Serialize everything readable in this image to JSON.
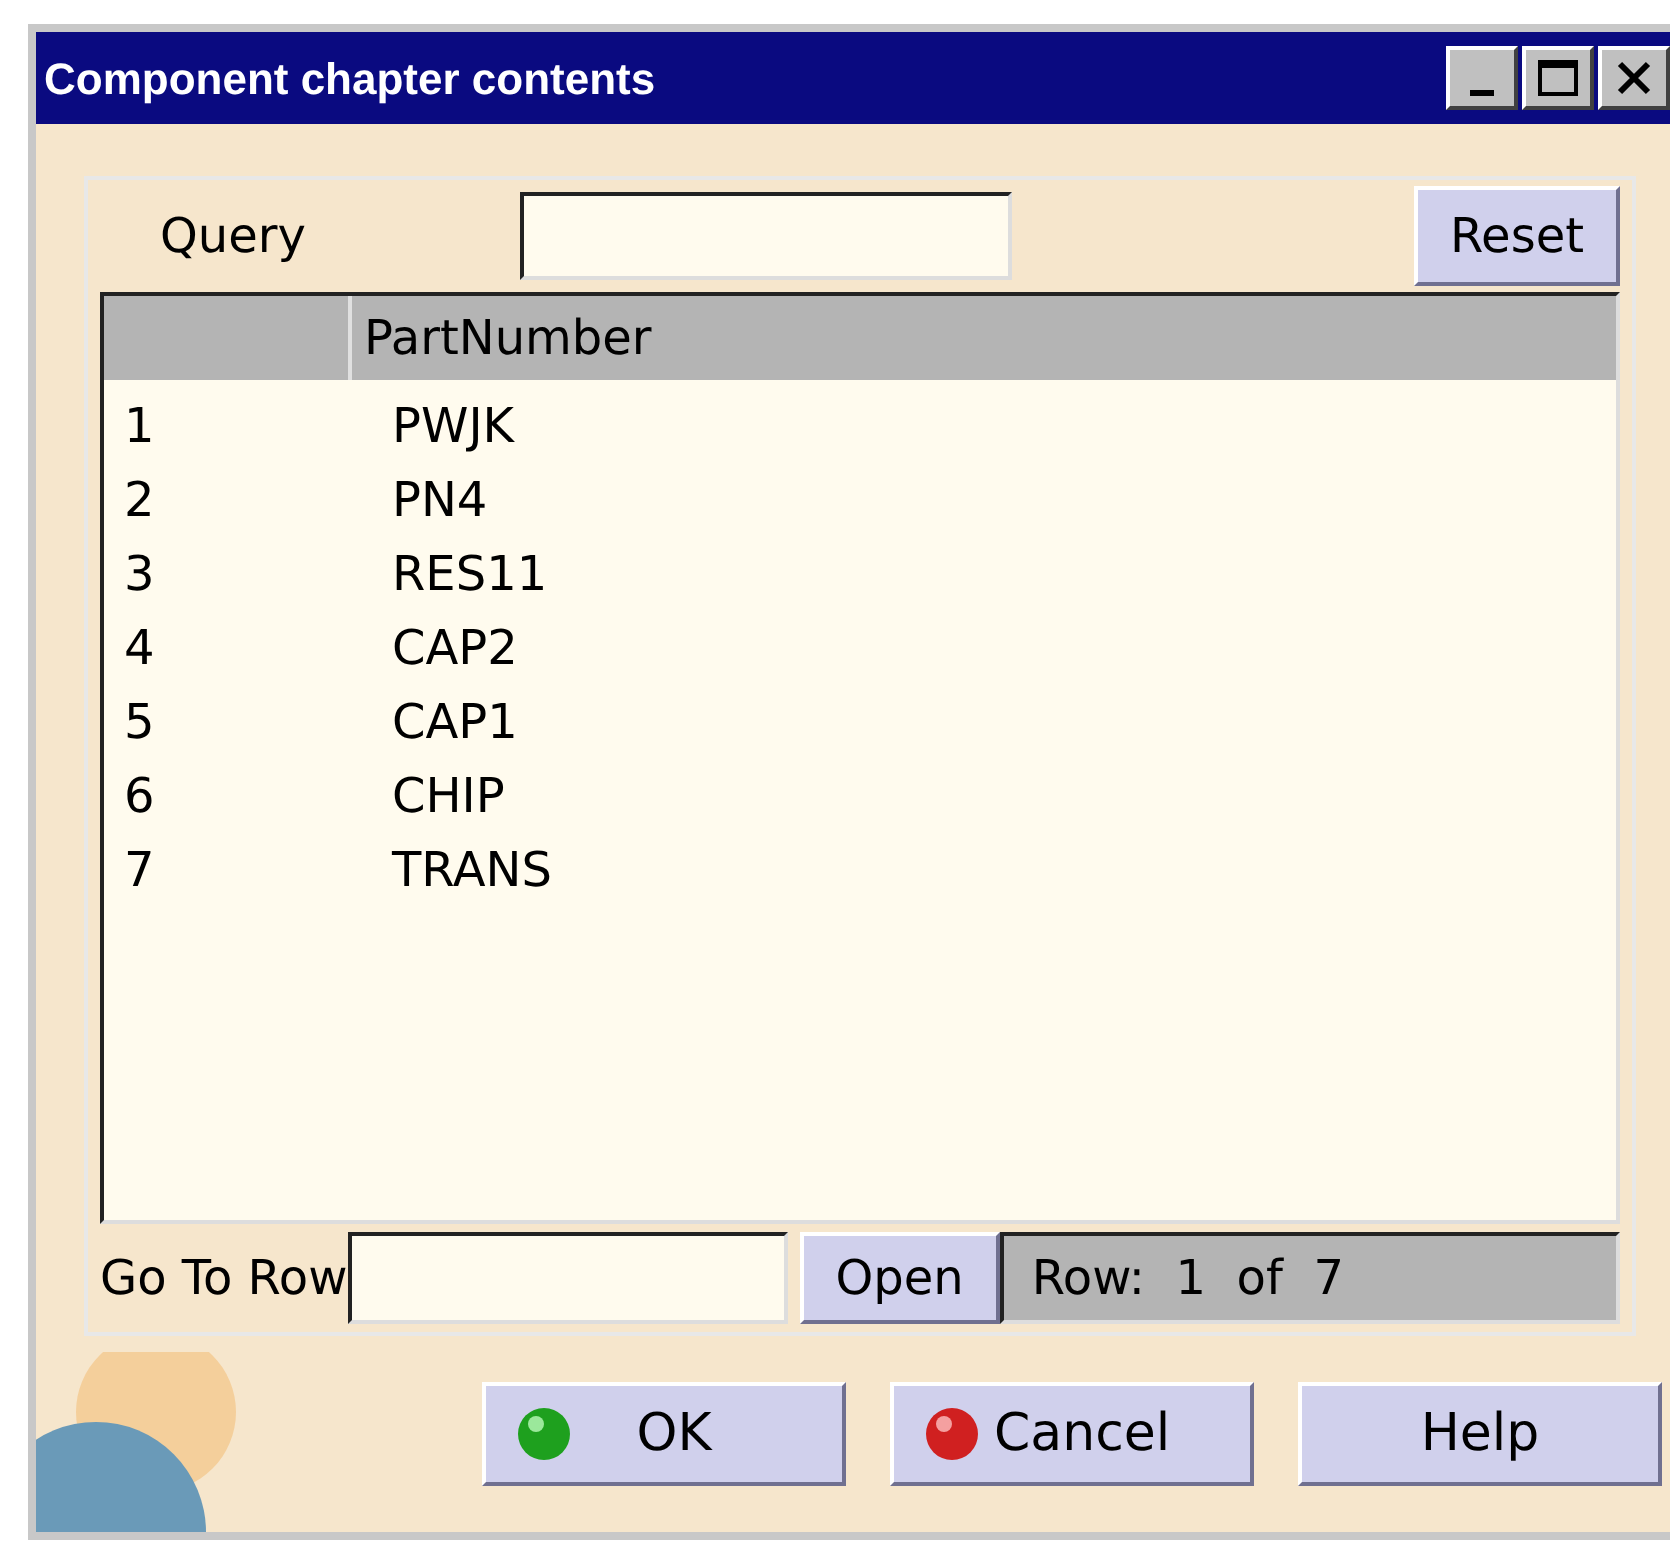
{
  "window": {
    "title": "Component chapter contents"
  },
  "query": {
    "label": "Query"
  },
  "reset_button": "Reset",
  "table": {
    "columns": [
      "",
      "PartNumber"
    ],
    "rows": [
      [
        "1",
        "PWJK"
      ],
      [
        "2",
        "PN4"
      ],
      [
        "3",
        "RES11"
      ],
      [
        "4",
        "CAP2"
      ],
      [
        "5",
        "CAP1"
      ],
      [
        "6",
        "CHIP"
      ],
      [
        "7",
        "TRANS"
      ]
    ]
  },
  "go_to_row": {
    "label": "Go To Row"
  },
  "open_button": "Open",
  "row_status": "Row:  1  of  7",
  "buttons": [
    {
      "kind": "ok",
      "label": "OK"
    },
    {
      "kind": "cancel",
      "label": "Cancel"
    },
    {
      "kind": "help",
      "label": "Help"
    }
  ]
}
